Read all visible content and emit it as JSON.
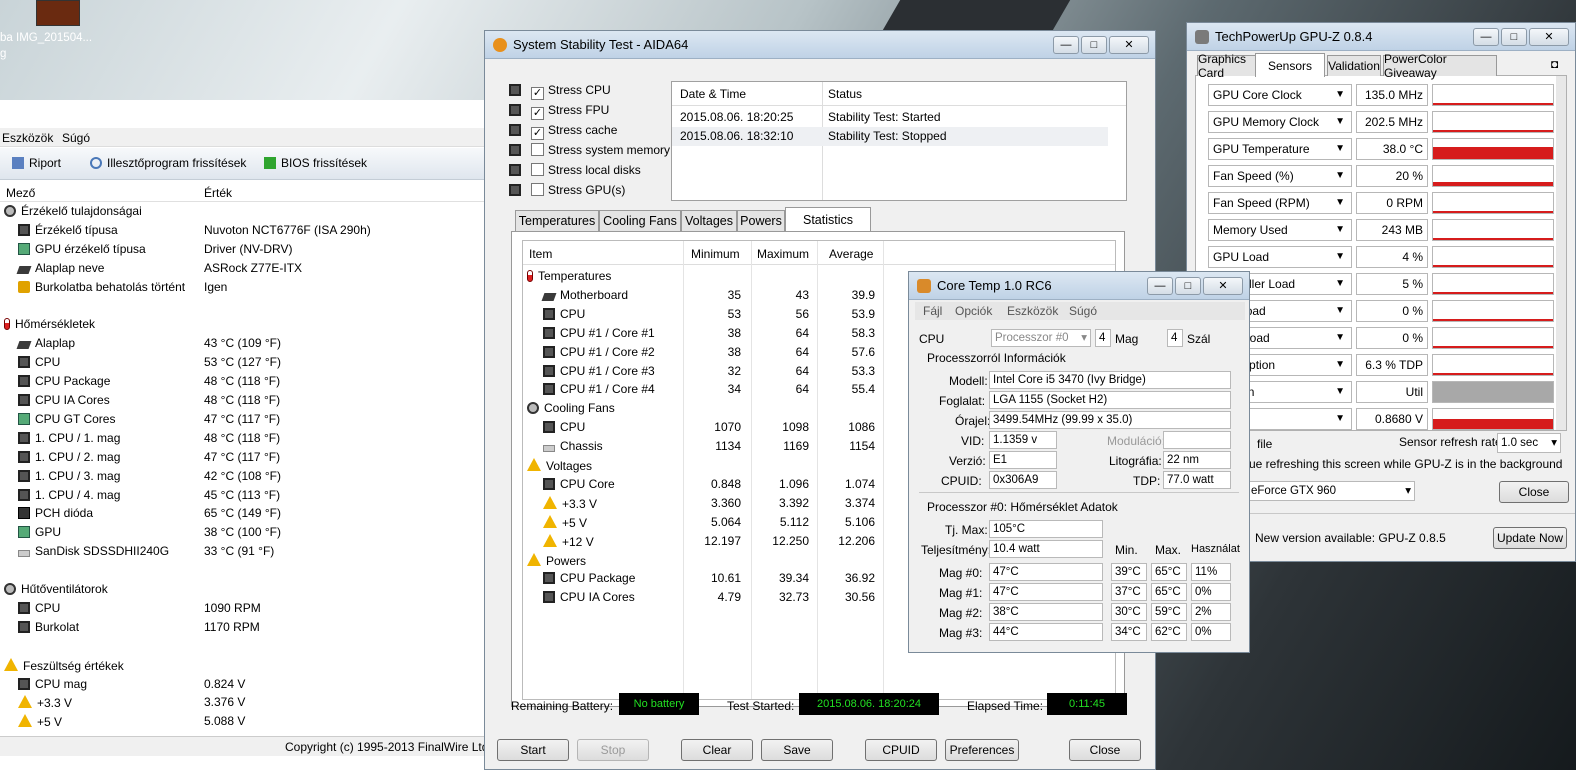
{
  "desktop": {
    "icon_label": "IMG_201504...",
    "left_fragment": "ba",
    "left_fragment2": "g"
  },
  "aida_main": {
    "menu": [
      "Eszközök",
      "Súgó"
    ],
    "toolbar": {
      "report": "Riport",
      "driver_update": "Illesztőprogram frissítések",
      "bios_update": "BIOS frissítések"
    },
    "columns": {
      "field": "Mező",
      "value": "Érték"
    },
    "rows": [
      {
        "icon": "sensor-icon",
        "label": "Érzékelő tulajdonságai",
        "value": "",
        "indent": 0
      },
      {
        "icon": "chip-icon",
        "label": "Érzékelő típusa",
        "value": "Nuvoton NCT6776F  (ISA 290h)",
        "indent": 1
      },
      {
        "icon": "gpu-icon",
        "label": "GPU érzékelő típusa",
        "value": "Driver  (NV-DRV)",
        "indent": 1
      },
      {
        "icon": "motherboard-icon",
        "label": "Alaplap neve",
        "value": "ASRock Z77E-ITX",
        "indent": 1
      },
      {
        "icon": "lock-icon",
        "label": "Burkolatba behatolás történt",
        "value": "Igen",
        "indent": 1
      },
      {
        "icon": "",
        "label": "",
        "value": "",
        "indent": 0
      },
      {
        "icon": "thermometer-icon",
        "label": "Hőmérsékletek",
        "value": "",
        "indent": 0
      },
      {
        "icon": "motherboard-icon",
        "label": "Alaplap",
        "value": "43 °C  (109 °F)",
        "indent": 1
      },
      {
        "icon": "chip-icon",
        "label": "CPU",
        "value": "53 °C  (127 °F)",
        "indent": 1
      },
      {
        "icon": "chip-icon",
        "label": "CPU Package",
        "value": "48 °C  (118 °F)",
        "indent": 1
      },
      {
        "icon": "chip-icon",
        "label": "CPU IA Cores",
        "value": "48 °C  (118 °F)",
        "indent": 1
      },
      {
        "icon": "gpu-icon",
        "label": "CPU GT Cores",
        "value": "47 °C  (117 °F)",
        "indent": 1
      },
      {
        "icon": "chip-icon",
        "label": "1. CPU / 1. mag",
        "value": "48 °C  (118 °F)",
        "indent": 1
      },
      {
        "icon": "chip-icon",
        "label": "1. CPU / 2. mag",
        "value": "47 °C  (117 °F)",
        "indent": 1
      },
      {
        "icon": "chip-icon",
        "label": "1. CPU / 3. mag",
        "value": "42 °C  (108 °F)",
        "indent": 1
      },
      {
        "icon": "chip-icon",
        "label": "1. CPU / 4. mag",
        "value": "45 °C  (113 °F)",
        "indent": 1
      },
      {
        "icon": "pch-icon",
        "label": "PCH dióda",
        "value": "65 °C  (149 °F)",
        "indent": 1
      },
      {
        "icon": "gpu-icon",
        "label": "GPU",
        "value": "38 °C  (100 °F)",
        "indent": 1
      },
      {
        "icon": "disk-icon",
        "label": "SanDisk SDSSDHII240G",
        "value": "33 °C  (91 °F)",
        "indent": 1
      },
      {
        "icon": "",
        "label": "",
        "value": "",
        "indent": 0
      },
      {
        "icon": "fan-icon",
        "label": "Hűtőventilátorok",
        "value": "",
        "indent": 0
      },
      {
        "icon": "chip-icon",
        "label": "CPU",
        "value": "1090 RPM",
        "indent": 1
      },
      {
        "icon": "chip-icon",
        "label": "Burkolat",
        "value": "1170 RPM",
        "indent": 1
      },
      {
        "icon": "",
        "label": "",
        "value": "",
        "indent": 0
      },
      {
        "icon": "warning-icon",
        "label": "Feszültség értékek",
        "value": "",
        "indent": 0
      },
      {
        "icon": "chip-icon",
        "label": "CPU mag",
        "value": "0.824 V",
        "indent": 1
      },
      {
        "icon": "warning-icon",
        "label": "+3.3 V",
        "value": "3.376 V",
        "indent": 1
      },
      {
        "icon": "warning-icon",
        "label": "+5 V",
        "value": "5.088 V",
        "indent": 1
      }
    ],
    "copyright": "Copyright (c) 1995-2013 FinalWire Ltd."
  },
  "stability": {
    "title": "System Stability Test - AIDA64",
    "stress": [
      {
        "label": "Stress CPU",
        "checked": true
      },
      {
        "label": "Stress FPU",
        "checked": true
      },
      {
        "label": "Stress cache",
        "checked": true
      },
      {
        "label": "Stress system memory",
        "checked": false
      },
      {
        "label": "Stress local disks",
        "checked": false
      },
      {
        "label": "Stress GPU(s)",
        "checked": false
      }
    ],
    "log_columns": {
      "date": "Date & Time",
      "status": "Status"
    },
    "log": [
      {
        "date": "2015.08.06. 18:20:25",
        "status": "Stability Test: Started"
      },
      {
        "date": "2015.08.06. 18:32:10",
        "status": "Stability Test: Stopped"
      }
    ],
    "tabs": [
      "Temperatures",
      "Cooling Fans",
      "Voltages",
      "Powers",
      "Statistics"
    ],
    "stat_columns": {
      "item": "Item",
      "min": "Minimum",
      "max": "Maximum",
      "avg": "Average"
    },
    "stats": [
      {
        "label": "Temperatures",
        "group": true,
        "icon": "thermometer-icon"
      },
      {
        "label": "Motherboard",
        "min": "35",
        "max": "43",
        "avg": "39.9",
        "icon": "motherboard-icon"
      },
      {
        "label": "CPU",
        "min": "53",
        "max": "56",
        "avg": "53.9",
        "icon": "chip-icon"
      },
      {
        "label": "CPU #1 / Core #1",
        "min": "38",
        "max": "64",
        "avg": "58.3",
        "icon": "chip-icon"
      },
      {
        "label": "CPU #1 / Core #2",
        "min": "38",
        "max": "64",
        "avg": "57.6",
        "icon": "chip-icon"
      },
      {
        "label": "CPU #1 / Core #3",
        "min": "32",
        "max": "64",
        "avg": "53.3",
        "icon": "chip-icon"
      },
      {
        "label": "CPU #1 / Core #4",
        "min": "34",
        "max": "64",
        "avg": "55.4",
        "icon": "chip-icon"
      },
      {
        "label": "Cooling Fans",
        "group": true,
        "icon": "fan-icon"
      },
      {
        "label": "CPU",
        "min": "1070",
        "max": "1098",
        "avg": "1086",
        "icon": "chip-icon"
      },
      {
        "label": "Chassis",
        "min": "1134",
        "max": "1169",
        "avg": "1154",
        "icon": "disk-icon"
      },
      {
        "label": "Voltages",
        "group": true,
        "icon": "warning-icon"
      },
      {
        "label": "CPU Core",
        "min": "0.848",
        "max": "1.096",
        "avg": "1.074",
        "icon": "chip-icon"
      },
      {
        "label": "+3.3 V",
        "min": "3.360",
        "max": "3.392",
        "avg": "3.374",
        "icon": "warning-icon"
      },
      {
        "label": "+5 V",
        "min": "5.064",
        "max": "5.112",
        "avg": "5.106",
        "icon": "warning-icon"
      },
      {
        "label": "+12 V",
        "min": "12.197",
        "max": "12.250",
        "avg": "12.206",
        "icon": "warning-icon"
      },
      {
        "label": "Powers",
        "group": true,
        "icon": "warning-icon"
      },
      {
        "label": "CPU Package",
        "min": "10.61",
        "max": "39.34",
        "avg": "36.92",
        "icon": "chip-icon"
      },
      {
        "label": "CPU IA Cores",
        "min": "4.79",
        "max": "32.73",
        "avg": "30.56",
        "icon": "chip-icon"
      }
    ],
    "status": {
      "battery_label": "Remaining Battery:",
      "battery_value": "No battery",
      "started_label": "Test Started:",
      "started_value": "2015.08.06. 18:20:24",
      "elapsed_label": "Elapsed Time:",
      "elapsed_value": "0:11:45"
    },
    "buttons": {
      "start": "Start",
      "stop": "Stop",
      "clear": "Clear",
      "save": "Save",
      "cpuid": "CPUID",
      "preferences": "Preferences",
      "close": "Close"
    }
  },
  "coretemp": {
    "title": "Core Temp 1.0 RC6",
    "menu": [
      "Fájl",
      "Opciók",
      "Eszközök",
      "Súgó"
    ],
    "cpu_label": "CPU",
    "cpu_select": "Processzor #0",
    "cores": "4",
    "cores_label": "Mag",
    "threads": "4",
    "threads_label": "Szál",
    "info_title": "Processzorról Információk",
    "model_label": "Modell:",
    "model": "Intel Core i5 3470 (Ivy Bridge)",
    "socket_label": "Foglalat:",
    "socket": "LGA 1155 (Socket H2)",
    "clock_label": "Órajel:",
    "clock": "3499.54MHz (99.99 x 35.0)",
    "vid_label": "VID:",
    "vid": "1.1359 v",
    "modulation_label": "Moduláció:",
    "modulation": "",
    "revision_label": "Verzió:",
    "revision": "E1",
    "lithography_label": "Litográfia:",
    "lithography": "22 nm",
    "cpuid_label": "CPUID:",
    "cpuid": "0x306A9",
    "tdp_label": "TDP:",
    "tdp": "77.0 watt",
    "temp_title": "Processzor #0: Hőmérséklet Adatok",
    "tjmax_label": "Tj. Max:",
    "tjmax": "105°C",
    "power_label": "Teljesítmény:",
    "power": "10.4 watt",
    "col_min": "Min.",
    "col_max": "Max.",
    "col_load": "Használat",
    "cores_data": [
      {
        "label": "Mag #0:",
        "temp": "47°C",
        "min": "39°C",
        "max": "65°C",
        "load": "11%"
      },
      {
        "label": "Mag #1:",
        "temp": "47°C",
        "min": "37°C",
        "max": "65°C",
        "load": "0%"
      },
      {
        "label": "Mag #2:",
        "temp": "38°C",
        "min": "30°C",
        "max": "59°C",
        "load": "2%"
      },
      {
        "label": "Mag #3:",
        "temp": "44°C",
        "min": "34°C",
        "max": "62°C",
        "load": "0%"
      }
    ]
  },
  "gpuz": {
    "title": "TechPowerUp GPU-Z 0.8.4",
    "tabs": [
      "Graphics Card",
      "Sensors",
      "Validation",
      "PowerColor Giveaway"
    ],
    "sensors": [
      {
        "label": "GPU Core Clock",
        "value": "135.0 MHz",
        "fill": 0.05
      },
      {
        "label": "GPU Memory Clock",
        "value": "202.5 MHz",
        "fill": 0.05
      },
      {
        "label": "GPU Temperature",
        "value": "38.0 °C",
        "fill": 0.6
      },
      {
        "label": "Fan Speed (%)",
        "value": "20 %",
        "fill": 0.2
      },
      {
        "label": "Fan Speed (RPM)",
        "value": "0 RPM",
        "fill": 0
      },
      {
        "label": "Memory Used",
        "value": "243 MB",
        "fill": 0.05
      },
      {
        "label": "GPU Load",
        "value": "4 %",
        "fill": 0.05
      },
      {
        "label": "Controller Load",
        "value": "5 %",
        "fill": 0.05
      },
      {
        "label": "gine Load",
        "value": "0 %",
        "fill": 0
      },
      {
        "label": "rface Load",
        "value": "0 %",
        "fill": 0
      },
      {
        "label": "onsumption",
        "value": "6.3 % TDP",
        "fill": 0.05
      },
      {
        "label": "Reason",
        "value": "Util",
        "fill": 1,
        "gray": true
      },
      {
        "label": "",
        "value": "0.8680 V",
        "fill": 0.5
      }
    ],
    "log_label": "file",
    "refresh_label": "Sensor refresh rate:",
    "refresh_value": "1.0 sec",
    "continue_label": "ue refreshing this screen while GPU-Z is in the background",
    "gpu_select": "eForce GTX 960",
    "close": "Close",
    "update_text": "New version available: GPU-Z 0.8.5",
    "update_button": "Update Now"
  }
}
